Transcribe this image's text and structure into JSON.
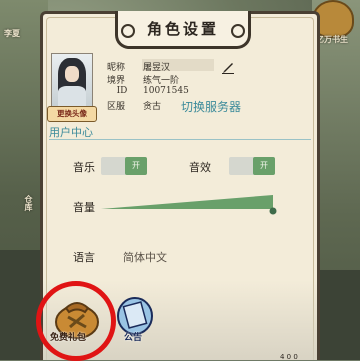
{
  "background": {
    "left_labels": [
      "李夏",
      "仓库"
    ],
    "right_labels": [
      "亿万书生"
    ]
  },
  "dialog": {
    "title": "角色设置",
    "avatar_button": "更换头像",
    "profile": {
      "nickname_label": "昵称",
      "nickname_value": "屠昱汉",
      "realm_label": "境界",
      "realm_value": "练气一阶",
      "id_label": "ID",
      "id_value": "10071545",
      "region_label": "区服",
      "region_value": "贪古"
    },
    "switch_server": "切换服务器",
    "user_center": "用户中心",
    "music_label": "音乐",
    "music_state": "开",
    "sfx_label": "音效",
    "sfx_state": "开",
    "volume_label": "音量",
    "volume_level": 1.0,
    "language_label": "语言",
    "language_value": "简体中文"
  },
  "bottom_bar": {
    "privilege_bag_label": "免费礼包",
    "notice_label": "公告",
    "corner_text": "4 0 0"
  },
  "colors": {
    "accent_teal": "#3b8a9a",
    "toggle_green": "#69a06a",
    "highlight_red": "#e01414",
    "panel_bg": "#f3ecd9"
  }
}
